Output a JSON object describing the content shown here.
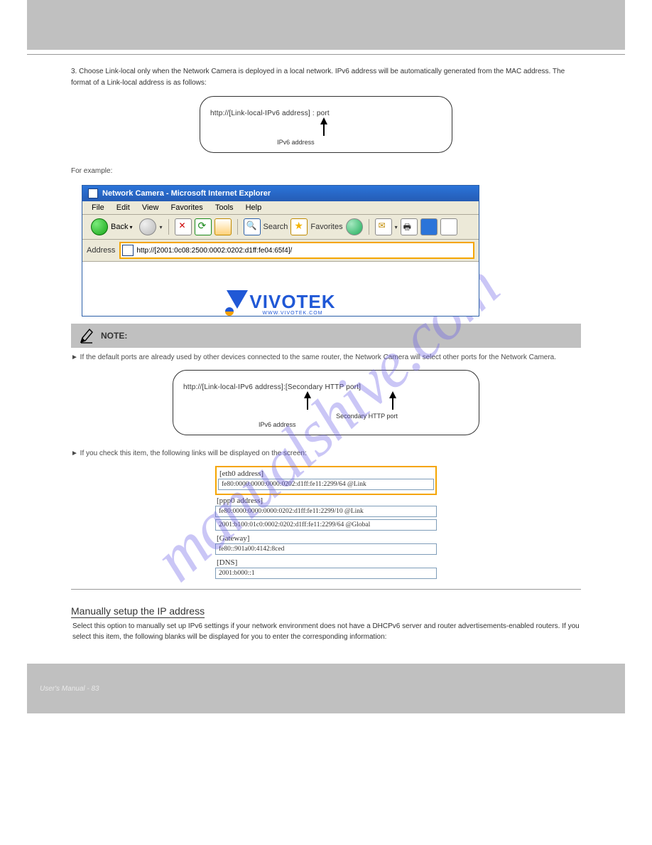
{
  "header": {
    "manual_title": "VIVOTEK"
  },
  "intro": "3. Choose Link-local only when the Network Camera is deployed in a local network. IPv6 address will be automatically generated from the MAC address. The format of a Link-local address is as follows:",
  "box1": {
    "line1": "http://[Link-local-IPv6 address] : port",
    "arrow_label": "IPv6 address"
  },
  "example1_label": "For example:",
  "ie": {
    "title": "Network Camera - Microsoft Internet Explorer",
    "menu": [
      "File",
      "Edit",
      "View",
      "Favorites",
      "Tools",
      "Help"
    ],
    "back": "Back",
    "search": "Search",
    "favorites": "Favorites",
    "addr_label": "Address",
    "addr_value": "http://[2001:0c08:2500:0002:0202:d1ff:fe04:65f4]/",
    "logo_text": "VIVOTEK",
    "logo_sub": "WWW.VIVOTEK.COM"
  },
  "note": {
    "label": "NOTE:",
    "text": "► If the default ports are already used by other devices connected to the same router, the Network Camera will select other ports for the Network Camera."
  },
  "box2": {
    "line1": "http://[Link-local-IPv6 address]:[Secondary HTTP port]",
    "arrow1": "IPv6 address",
    "arrow2": "Secondary HTTP port"
  },
  "example2_lead": "► If you check this item, the following links will be displayed on the screen:",
  "ipinfo": {
    "eth0_label": "[eth0 address]",
    "eth0_val": "fe80:0000:0000:0000:0202:d1ff:fe11:2299/64 @Link",
    "ppp0_label": "[ppp0 address]",
    "ppp0_val1": "fe80:0000:0000:0000:0202:d1ff:fe11:2299/10 @Link",
    "ppp0_val2": "2001:b100:01c0:0002:0202:d1ff:fe11:2299/64 @Global",
    "gw_label": "[Gateway]",
    "gw_val": "fe80::901a00:4142:8ced",
    "dns_label": "[DNS]",
    "dns_val": "2001:b000::1"
  },
  "footer_hr": "",
  "section_title": "Manually setup the IP address",
  "manual_text": "Select this option to manually set up IPv6 settings if your network environment does not have a DHCPv6 server and router advertisements-enabled routers. If you select this item, the following blanks will be displayed for you to enter the corresponding information:",
  "footer": {
    "left": "User's Manual - 83",
    "right": ""
  },
  "watermark": "manualshive.com"
}
